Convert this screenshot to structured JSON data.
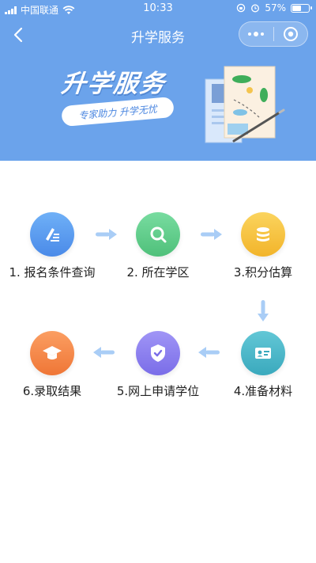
{
  "status": {
    "carrier": "中国联通",
    "time": "10:33",
    "battery": "57%"
  },
  "nav": {
    "title": "升学服务"
  },
  "banner": {
    "title": "升学服务",
    "tagline": "专家助力  升学无忧"
  },
  "steps": [
    {
      "label": "1. 报名条件查询",
      "icon": "pen-list-icon",
      "color": "#5b9cf0"
    },
    {
      "label": "2. 所在学区",
      "icon": "search-icon",
      "color": "#5fcf8c"
    },
    {
      "label": "3.积分估算",
      "icon": "coin-stack-icon",
      "color": "#f6c340"
    },
    {
      "label": "4.准备材料",
      "icon": "id-card-icon",
      "color": "#4fb8c9"
    },
    {
      "label": "5.网上申请学位",
      "icon": "shield-check-icon",
      "color": "#8b7ff0"
    },
    {
      "label": "6.录取结果",
      "icon": "graduation-cap-icon",
      "color": "#f58a4c"
    }
  ]
}
